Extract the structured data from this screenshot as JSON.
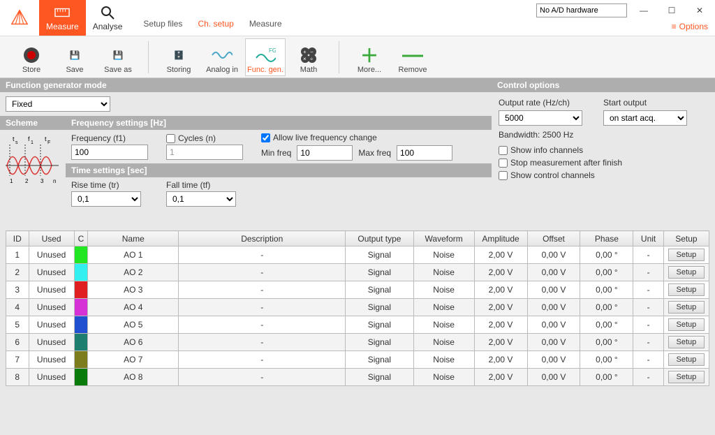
{
  "window": {
    "hardware": "No A/D hardware",
    "options": "Options"
  },
  "ribbon": {
    "measure": "Measure",
    "analyse": "Analyse",
    "tabs": {
      "setup_files": "Setup files",
      "ch_setup": "Ch. setup",
      "measure": "Measure"
    }
  },
  "toolbar": {
    "store": "Store",
    "save": "Save",
    "saveas": "Save as",
    "storing": "Storing",
    "analogin": "Analog in",
    "funcgen": "Func. gen.",
    "math": "Math",
    "more": "More...",
    "remove": "Remove"
  },
  "fg": {
    "title": "Function generator mode",
    "mode": "Fixed",
    "scheme_title": "Scheme",
    "freq_title": "Frequency settings [Hz]",
    "freq_label": "Frequency (f1)",
    "freq_value": "100",
    "cycles_label": "Cycles (n)",
    "cycles_value": "1",
    "allow_live": "Allow live frequency change",
    "min_label": "Min freq",
    "min_value": "10",
    "max_label": "Max freq",
    "max_value": "100",
    "time_title": "Time settings [sec]",
    "rise_label": "Rise time (tr)",
    "rise_value": "0,1",
    "fall_label": "Fall time (tf)",
    "fall_value": "0,1"
  },
  "ctrl": {
    "title": "Control options",
    "rate_label": "Output rate (Hz/ch)",
    "rate_value": "5000",
    "start_label": "Start output",
    "start_value": "on start acq.",
    "bw": "Bandwidth: 2500 Hz",
    "show_info": "Show info channels",
    "stop_after": "Stop measurement after finish",
    "show_ctrl": "Show control channels"
  },
  "table": {
    "headers": {
      "id": "ID",
      "used": "Used",
      "c": "C",
      "name": "Name",
      "desc": "Description",
      "out": "Output type",
      "wave": "Waveform",
      "amp": "Amplitude",
      "off": "Offset",
      "ph": "Phase",
      "unit": "Unit",
      "setup": "Setup"
    },
    "setup_btn": "Setup",
    "rows": [
      {
        "id": "1",
        "used": "Unused",
        "color": "#22e622",
        "name": "AO 1",
        "desc": "-",
        "out": "Signal",
        "wave": "Noise",
        "amp": "2,00 V",
        "off": "0,00 V",
        "ph": "0,00 °",
        "unit": "-"
      },
      {
        "id": "2",
        "used": "Unused",
        "color": "#33f0f0",
        "name": "AO 2",
        "desc": "-",
        "out": "Signal",
        "wave": "Noise",
        "amp": "2,00 V",
        "off": "0,00 V",
        "ph": "0,00 °",
        "unit": "-"
      },
      {
        "id": "3",
        "used": "Unused",
        "color": "#e02020",
        "name": "AO 3",
        "desc": "-",
        "out": "Signal",
        "wave": "Noise",
        "amp": "2,00 V",
        "off": "0,00 V",
        "ph": "0,00 °",
        "unit": "-"
      },
      {
        "id": "4",
        "used": "Unused",
        "color": "#d631d6",
        "name": "AO 4",
        "desc": "-",
        "out": "Signal",
        "wave": "Noise",
        "amp": "2,00 V",
        "off": "0,00 V",
        "ph": "0,00 °",
        "unit": "-"
      },
      {
        "id": "5",
        "used": "Unused",
        "color": "#2050d0",
        "name": "AO 5",
        "desc": "-",
        "out": "Signal",
        "wave": "Noise",
        "amp": "2,00 V",
        "off": "0,00 V",
        "ph": "0,00 °",
        "unit": "-"
      },
      {
        "id": "6",
        "used": "Unused",
        "color": "#1d7d6e",
        "name": "AO 6",
        "desc": "-",
        "out": "Signal",
        "wave": "Noise",
        "amp": "2,00 V",
        "off": "0,00 V",
        "ph": "0,00 °",
        "unit": "-"
      },
      {
        "id": "7",
        "used": "Unused",
        "color": "#7d7d1d",
        "name": "AO 7",
        "desc": "-",
        "out": "Signal",
        "wave": "Noise",
        "amp": "2,00 V",
        "off": "0,00 V",
        "ph": "0,00 °",
        "unit": "-"
      },
      {
        "id": "8",
        "used": "Unused",
        "color": "#0a7a0a",
        "name": "AO 8",
        "desc": "-",
        "out": "Signal",
        "wave": "Noise",
        "amp": "2,00 V",
        "off": "0,00 V",
        "ph": "0,00 °",
        "unit": "-"
      }
    ]
  }
}
